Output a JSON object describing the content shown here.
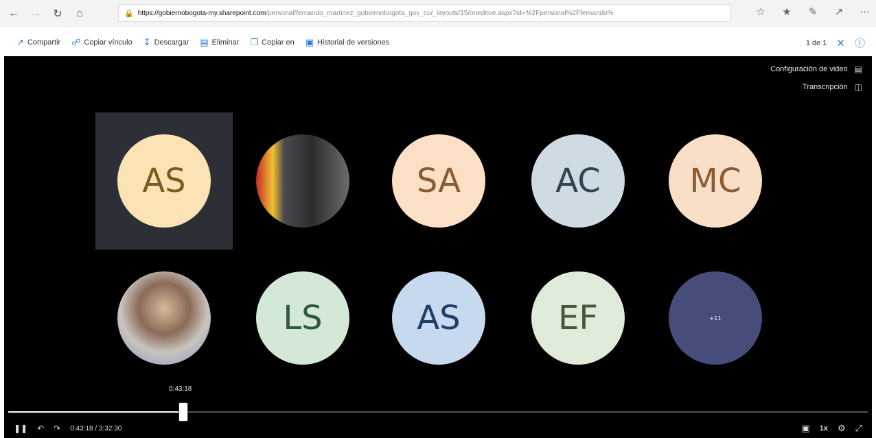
{
  "browser": {
    "url_domain": "https://gobiernobogota-my.sharepoint.com",
    "url_path": "/personal/fernando_martinez_gobiernobogota_gov_co/_layouts/15/onedrive.aspx?id=%2Fpersonal%2Ffernando%"
  },
  "toolbar": {
    "items": [
      {
        "label": "Compartir",
        "icon": "share-icon"
      },
      {
        "label": "Copiar vínculo",
        "icon": "link-icon"
      },
      {
        "label": "Descargar",
        "icon": "download-icon"
      },
      {
        "label": "Eliminar",
        "icon": "trash-icon"
      },
      {
        "label": "Copiar en",
        "icon": "copy-icon"
      },
      {
        "label": "Historial de versiones",
        "icon": "history-icon"
      }
    ],
    "page_count": "1 de 1"
  },
  "video": {
    "config_label": "Configuración de video",
    "transcript_label": "Transcripción",
    "seek_tooltip": "0:43:18",
    "current_time": "0:43:18",
    "separator": "/",
    "total_time": "3:32:30",
    "progress_fraction": 0.2039,
    "speed": "1x"
  },
  "participants": [
    {
      "initials": "AS",
      "bg": "#fbe3b5",
      "fg": "#7a5d1d",
      "name": ""
    },
    {
      "initials": "",
      "bg": "#3a4a5a",
      "fg": "#ffffff",
      "name": "",
      "photo": true
    },
    {
      "initials": "SA",
      "bg": "#fbe0c6",
      "fg": "#8a5a33",
      "name": ""
    },
    {
      "initials": "AC",
      "bg": "#cfdbe3",
      "fg": "#2e4452",
      "name": ""
    },
    {
      "initials": "MC",
      "bg": "#f9dfc8",
      "fg": "#8a5a33",
      "name": ""
    },
    {
      "initials": "",
      "bg": "#b9a995",
      "fg": "#ffffff",
      "name": "",
      "photo": true
    },
    {
      "initials": "LS",
      "bg": "#d4e8d8",
      "fg": "#2e5a3c",
      "name": ""
    },
    {
      "initials": "AS",
      "bg": "#c7d9ee",
      "fg": "#1f3f66",
      "name": ""
    },
    {
      "initials": "EF",
      "bg": "#e0ead8",
      "fg": "#44573a",
      "name": ""
    },
    {
      "initials": "+11",
      "bg": "#474d7a",
      "fg": "#ffffff",
      "name": ""
    }
  ]
}
